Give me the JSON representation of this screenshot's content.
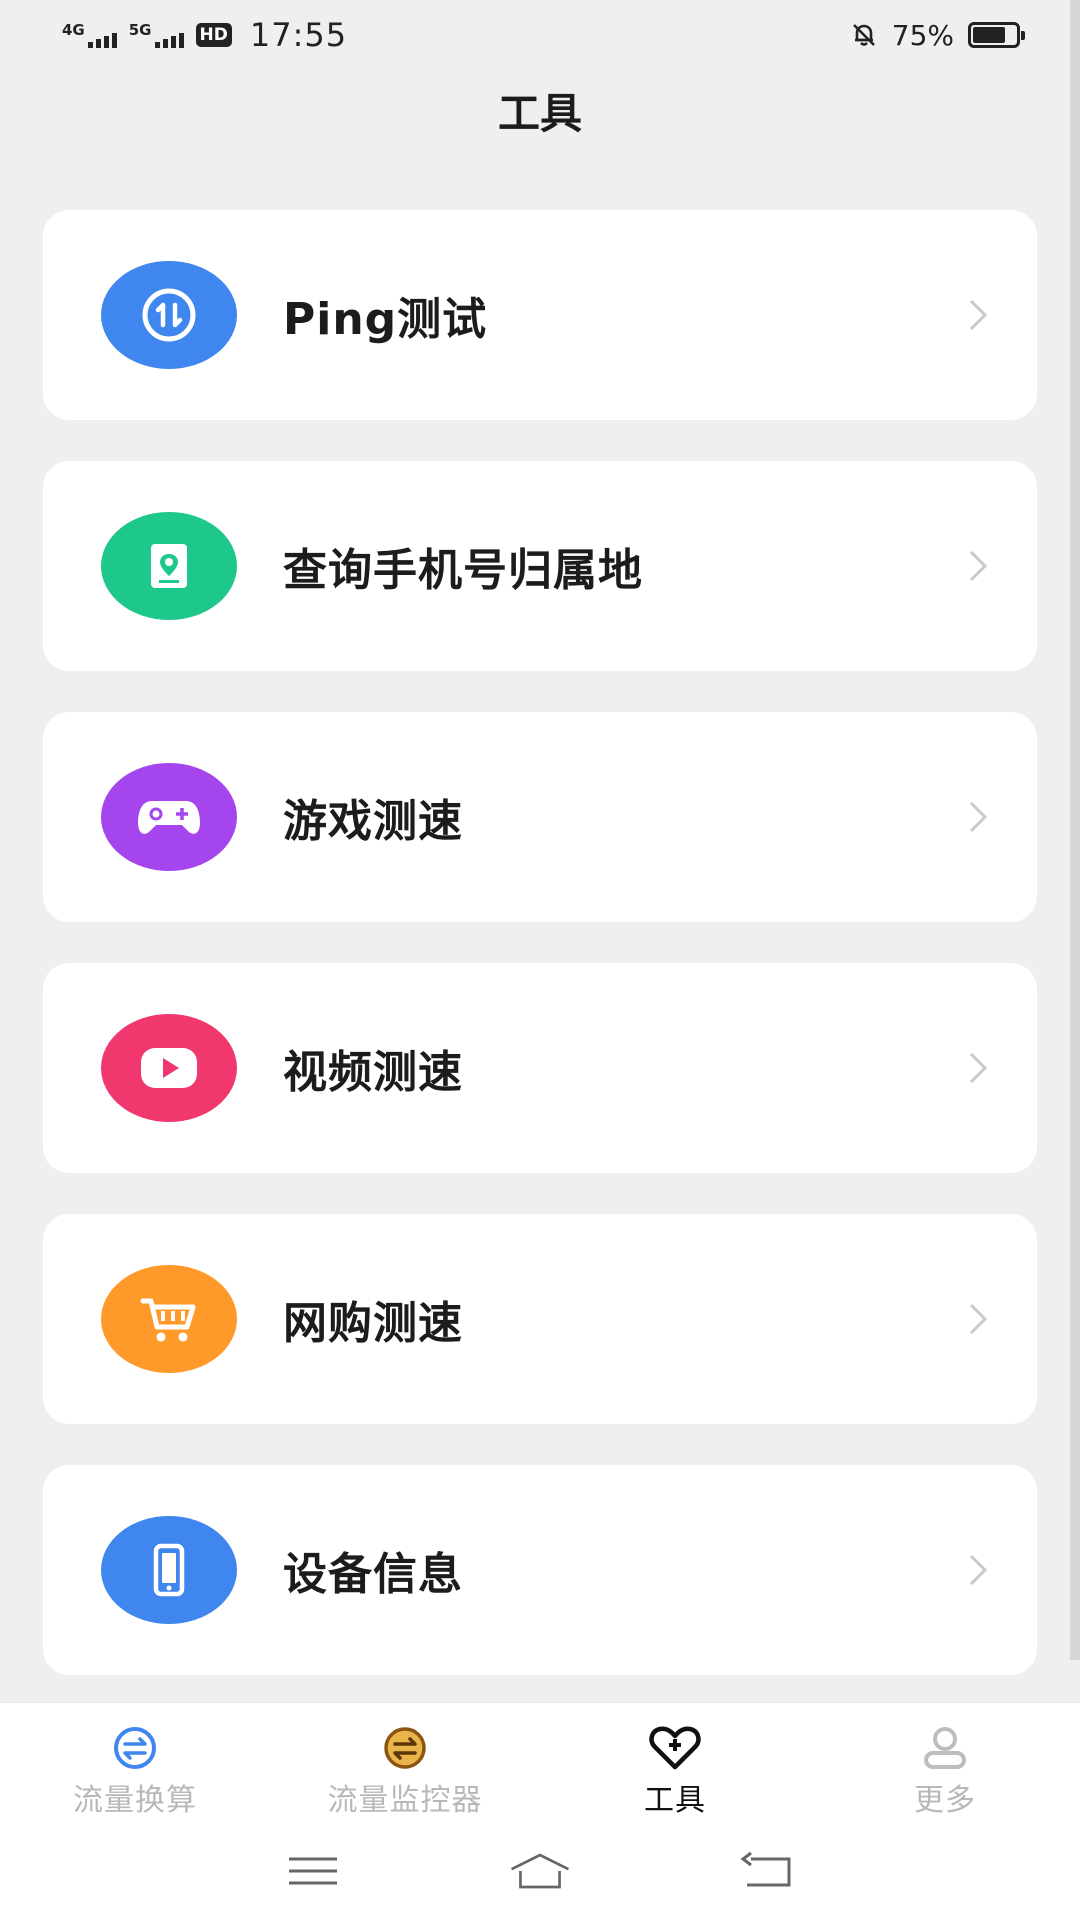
{
  "status_bar": {
    "net1": "4G",
    "net2": "5G",
    "hd": "HD",
    "time": "17:55",
    "battery_percent": "75%",
    "battery_level": 0.75
  },
  "page": {
    "title": "工具"
  },
  "tools": [
    {
      "label": "Ping测试",
      "icon": "ping-icon",
      "color": "#3f86ee"
    },
    {
      "label": "查询手机号归属地",
      "icon": "location-icon",
      "color": "#1ec78a"
    },
    {
      "label": "游戏测速",
      "icon": "gamepad-icon",
      "color": "#a445ee"
    },
    {
      "label": "视频测速",
      "icon": "play-icon",
      "color": "#f0386f"
    },
    {
      "label": "网购测速",
      "icon": "cart-icon",
      "color": "#ff9a2a"
    },
    {
      "label": "设备信息",
      "icon": "phone-icon",
      "color": "#3f86ee"
    }
  ],
  "bottom_nav": {
    "items": [
      {
        "label": "流量换算",
        "icon": "convert-icon",
        "color": "#3f86ee"
      },
      {
        "label": "流量监控器",
        "icon": "monitor-icon",
        "color": "#b0721c"
      },
      {
        "label": "工具",
        "icon": "heart-plus-icon",
        "color": "#111111"
      },
      {
        "label": "更多",
        "icon": "user-icon",
        "color": "#bdbdbd"
      }
    ],
    "active_index": 2
  },
  "system_nav": [
    "menu-icon",
    "home-icon",
    "back-icon"
  ]
}
